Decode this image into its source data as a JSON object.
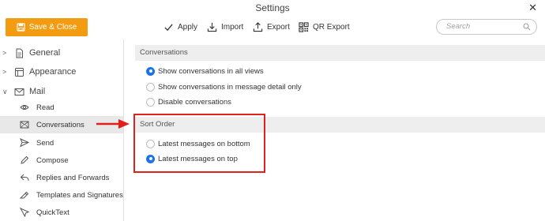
{
  "window": {
    "title": "Settings"
  },
  "toolbar": {
    "save_close": "Save & Close",
    "apply": "Apply",
    "import": "Import",
    "export": "Export",
    "qr_export": "QR Export",
    "search_placeholder": "Search"
  },
  "sidebar": {
    "categories": [
      {
        "label": "General",
        "expanded": false
      },
      {
        "label": "Appearance",
        "expanded": false
      },
      {
        "label": "Mail",
        "expanded": true
      }
    ],
    "mail_items": [
      {
        "label": "Read",
        "icon": "eye-icon"
      },
      {
        "label": "Conversations",
        "icon": "conversations-icon",
        "active": true
      },
      {
        "label": "Send",
        "icon": "send-icon"
      },
      {
        "label": "Compose",
        "icon": "pencil-icon"
      },
      {
        "label": "Replies and Forwards",
        "icon": "reply-icon"
      },
      {
        "label": "Templates and Signatures",
        "icon": "signature-icon"
      },
      {
        "label": "QuickText",
        "icon": "quicktext-icon"
      }
    ]
  },
  "main": {
    "conversations": {
      "header": "Conversations",
      "options": [
        {
          "label": "Show conversations in all views",
          "checked": true
        },
        {
          "label": "Show conversations in message detail only",
          "checked": false
        },
        {
          "label": "Disable conversations",
          "checked": false
        }
      ]
    },
    "sort_order": {
      "header": "Sort Order",
      "options": [
        {
          "label": "Latest messages on bottom",
          "checked": false
        },
        {
          "label": "Latest messages on top",
          "checked": true
        }
      ]
    }
  },
  "colors": {
    "accent": "#f39c12",
    "radio_checked": "#1a73e8",
    "annotation": "#e0201c"
  }
}
